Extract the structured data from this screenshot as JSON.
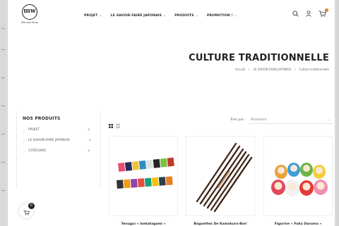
{
  "brand": {
    "logo_mark": "mw",
    "logo_subtitle": "Maruwa Shop"
  },
  "nav": [
    {
      "label": "PROJET"
    },
    {
      "label": "LE SAVOIR-FAIRE JAPONAIS"
    },
    {
      "label": "PRODUITS"
    },
    {
      "label": "PROMOTION !"
    }
  ],
  "header_icons": [
    "search-icon",
    "user-icon",
    "cart-icon"
  ],
  "page": {
    "title": "CULTURE TRADITIONNELLE",
    "breadcrumb": [
      "Accueil",
      "LE SAVOIR-FAIRE JAPONAIS",
      "Culture traditionnelle"
    ]
  },
  "sidebar": {
    "title": "NOS PRODUITS",
    "items": [
      {
        "label": "PROJET"
      },
      {
        "label": "LE SAVOIR-FAIRE JAPONAIS"
      },
      {
        "label": "CATÉGORIE"
      }
    ]
  },
  "toolbar": {
    "sort_label": "Trier par :",
    "sort_value": "Pertinence"
  },
  "products": [
    {
      "name": "Tenugui « Isekatagami »"
    },
    {
      "name": "Baguettes De Kamakura-Bori"
    },
    {
      "name": "Figurine « Fuku Daruma »"
    }
  ],
  "floating_cart": {
    "count": "0"
  },
  "colors": {
    "accent": "#d9822b",
    "text": "#2b2b2b"
  }
}
